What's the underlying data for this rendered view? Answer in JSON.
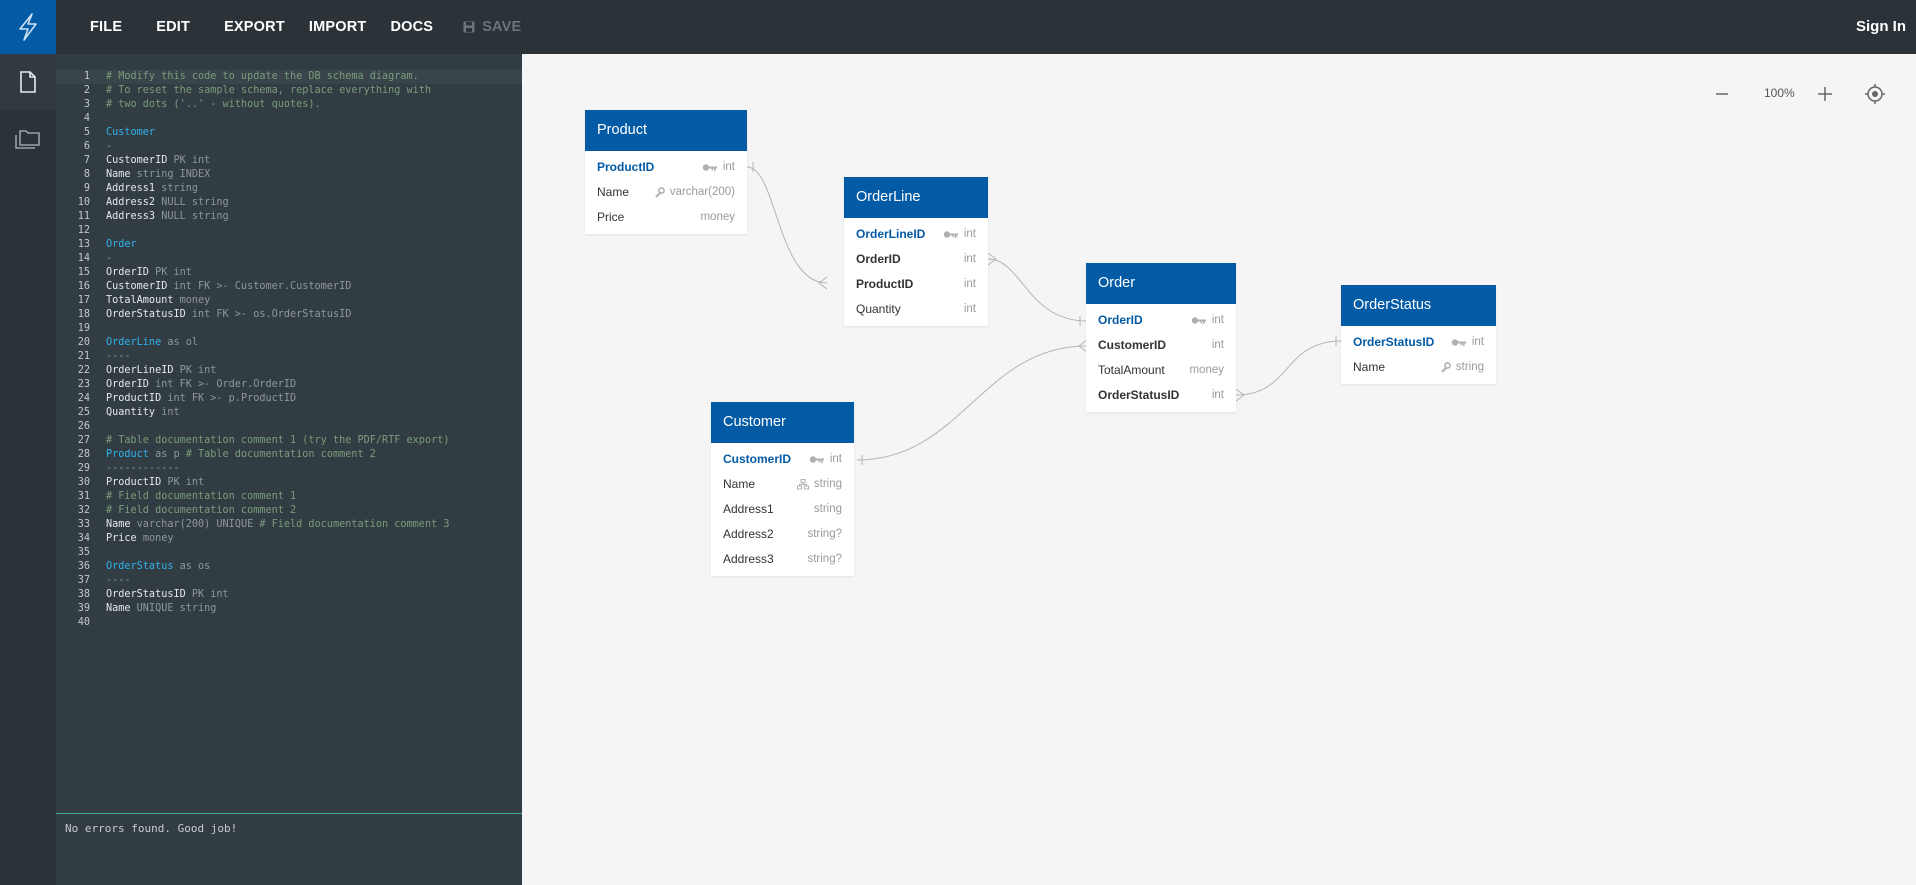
{
  "menu": {
    "file": "FILE",
    "edit": "EDIT",
    "export": "EXPORT",
    "import": "IMPORT",
    "docs": "DOCS",
    "save": "SAVE",
    "signin": "Sign In"
  },
  "code_lines": [
    {
      "n": "1",
      "parts": [
        {
          "t": "# Modify this code to update the DB schema diagram.",
          "c": "c"
        }
      ]
    },
    {
      "n": "2",
      "parts": [
        {
          "t": "# To reset the sample schema, replace everything with",
          "c": "c"
        }
      ]
    },
    {
      "n": "3",
      "parts": [
        {
          "t": "# two dots ('..' - without quotes).",
          "c": "c"
        }
      ]
    },
    {
      "n": "4",
      "parts": []
    },
    {
      "n": "5",
      "parts": [
        {
          "t": "Customer",
          "c": "t"
        }
      ]
    },
    {
      "n": "6",
      "parts": [
        {
          "t": "-",
          "c": "k"
        }
      ]
    },
    {
      "n": "7",
      "parts": [
        {
          "t": "CustomerID ",
          "c": "n"
        },
        {
          "t": "PK int",
          "c": "k"
        }
      ]
    },
    {
      "n": "8",
      "parts": [
        {
          "t": "Name ",
          "c": "n"
        },
        {
          "t": "string INDEX",
          "c": "k"
        }
      ]
    },
    {
      "n": "9",
      "parts": [
        {
          "t": "Address1 ",
          "c": "n"
        },
        {
          "t": "string",
          "c": "k"
        }
      ]
    },
    {
      "n": "10",
      "parts": [
        {
          "t": "Address2 ",
          "c": "n"
        },
        {
          "t": "NULL string",
          "c": "k"
        }
      ]
    },
    {
      "n": "11",
      "parts": [
        {
          "t": "Address3 ",
          "c": "n"
        },
        {
          "t": "NULL string",
          "c": "k"
        }
      ]
    },
    {
      "n": "12",
      "parts": []
    },
    {
      "n": "13",
      "parts": [
        {
          "t": "Order",
          "c": "t"
        }
      ]
    },
    {
      "n": "14",
      "parts": [
        {
          "t": "-",
          "c": "k"
        }
      ]
    },
    {
      "n": "15",
      "parts": [
        {
          "t": "OrderID ",
          "c": "n"
        },
        {
          "t": "PK int",
          "c": "k"
        }
      ]
    },
    {
      "n": "16",
      "parts": [
        {
          "t": "CustomerID ",
          "c": "n"
        },
        {
          "t": "int FK >- Customer.CustomerID",
          "c": "k"
        }
      ]
    },
    {
      "n": "17",
      "parts": [
        {
          "t": "TotalAmount ",
          "c": "n"
        },
        {
          "t": "money",
          "c": "k"
        }
      ]
    },
    {
      "n": "18",
      "parts": [
        {
          "t": "OrderStatusID ",
          "c": "n"
        },
        {
          "t": "int FK >- os.OrderStatusID",
          "c": "k"
        }
      ]
    },
    {
      "n": "19",
      "parts": []
    },
    {
      "n": "20",
      "parts": [
        {
          "t": "OrderLine",
          "c": "t"
        },
        {
          "t": " as ol",
          "c": "k"
        }
      ]
    },
    {
      "n": "21",
      "parts": [
        {
          "t": "----",
          "c": "k"
        }
      ]
    },
    {
      "n": "22",
      "parts": [
        {
          "t": "OrderLineID ",
          "c": "n"
        },
        {
          "t": "PK int",
          "c": "k"
        }
      ]
    },
    {
      "n": "23",
      "parts": [
        {
          "t": "OrderID ",
          "c": "n"
        },
        {
          "t": "int FK >- Order.OrderID",
          "c": "k"
        }
      ]
    },
    {
      "n": "24",
      "parts": [
        {
          "t": "ProductID ",
          "c": "n"
        },
        {
          "t": "int FK >- p.ProductID",
          "c": "k"
        }
      ]
    },
    {
      "n": "25",
      "parts": [
        {
          "t": "Quantity ",
          "c": "n"
        },
        {
          "t": "int",
          "c": "k"
        }
      ]
    },
    {
      "n": "26",
      "parts": []
    },
    {
      "n": "27",
      "parts": [
        {
          "t": "# Table documentation comment 1 (try the PDF/RTF export)",
          "c": "c"
        }
      ]
    },
    {
      "n": "28",
      "parts": [
        {
          "t": "Product",
          "c": "t"
        },
        {
          "t": " as p ",
          "c": "k"
        },
        {
          "t": "# Table documentation comment 2",
          "c": "c"
        }
      ]
    },
    {
      "n": "29",
      "parts": [
        {
          "t": "------------",
          "c": "k"
        }
      ]
    },
    {
      "n": "30",
      "parts": [
        {
          "t": "ProductID ",
          "c": "n"
        },
        {
          "t": "PK int",
          "c": "k"
        }
      ]
    },
    {
      "n": "31",
      "parts": [
        {
          "t": "# Field documentation comment 1",
          "c": "c"
        }
      ]
    },
    {
      "n": "32",
      "parts": [
        {
          "t": "# Field documentation comment 2",
          "c": "c"
        }
      ]
    },
    {
      "n": "33",
      "parts": [
        {
          "t": "Name ",
          "c": "n"
        },
        {
          "t": "varchar(200) UNIQUE ",
          "c": "k"
        },
        {
          "t": "# Field documentation comment 3",
          "c": "c"
        }
      ]
    },
    {
      "n": "34",
      "parts": [
        {
          "t": "Price ",
          "c": "n"
        },
        {
          "t": "money",
          "c": "k"
        }
      ]
    },
    {
      "n": "35",
      "parts": []
    },
    {
      "n": "36",
      "parts": [
        {
          "t": "OrderStatus",
          "c": "t"
        },
        {
          "t": " as os",
          "c": "k"
        }
      ]
    },
    {
      "n": "37",
      "parts": [
        {
          "t": "----",
          "c": "k"
        }
      ]
    },
    {
      "n": "38",
      "parts": [
        {
          "t": "OrderStatusID ",
          "c": "n"
        },
        {
          "t": "PK int",
          "c": "k"
        }
      ]
    },
    {
      "n": "39",
      "parts": [
        {
          "t": "Name ",
          "c": "n"
        },
        {
          "t": "UNIQUE string",
          "c": "k"
        }
      ]
    },
    {
      "n": "40",
      "parts": []
    }
  ],
  "status": "No errors found. Good job!",
  "zoom": "100%",
  "tables": {
    "product": {
      "title": "Product",
      "fields": [
        {
          "name": "ProductID",
          "type": "int",
          "icon": "key-icon",
          "pk": true
        },
        {
          "name": "Name",
          "type": "varchar(200)",
          "icon": "wrench-icon"
        },
        {
          "name": "Price",
          "type": "money"
        }
      ]
    },
    "orderline": {
      "title": "OrderLine",
      "fields": [
        {
          "name": "OrderLineID",
          "type": "int",
          "icon": "key-icon",
          "pk": true
        },
        {
          "name": "OrderID",
          "type": "int",
          "bold": true
        },
        {
          "name": "ProductID",
          "type": "int",
          "bold": true
        },
        {
          "name": "Quantity",
          "type": "int"
        }
      ]
    },
    "order": {
      "title": "Order",
      "fields": [
        {
          "name": "OrderID",
          "type": "int",
          "icon": "key-icon",
          "pk": true
        },
        {
          "name": "CustomerID",
          "type": "int",
          "bold": true
        },
        {
          "name": "TotalAmount",
          "type": "money"
        },
        {
          "name": "OrderStatusID",
          "type": "int",
          "bold": true
        }
      ]
    },
    "orderstatus": {
      "title": "OrderStatus",
      "fields": [
        {
          "name": "OrderStatusID",
          "type": "int",
          "icon": "key-icon",
          "pk": true
        },
        {
          "name": "Name",
          "type": "string",
          "icon": "wrench-icon"
        }
      ]
    },
    "customer": {
      "title": "Customer",
      "fields": [
        {
          "name": "CustomerID",
          "type": "int",
          "icon": "key-icon",
          "pk": true
        },
        {
          "name": "Name",
          "type": "string",
          "icon": "index-icon"
        },
        {
          "name": "Address1",
          "type": "string"
        },
        {
          "name": "Address2",
          "type": "string?"
        },
        {
          "name": "Address3",
          "type": "string?"
        }
      ]
    }
  },
  "colors": {
    "brand_blue": "#035aa5",
    "dark_bg": "#2b3339",
    "editor_bg": "#323c43",
    "type_keyword": "#31b4ee",
    "comment": "#7b9c7b"
  }
}
